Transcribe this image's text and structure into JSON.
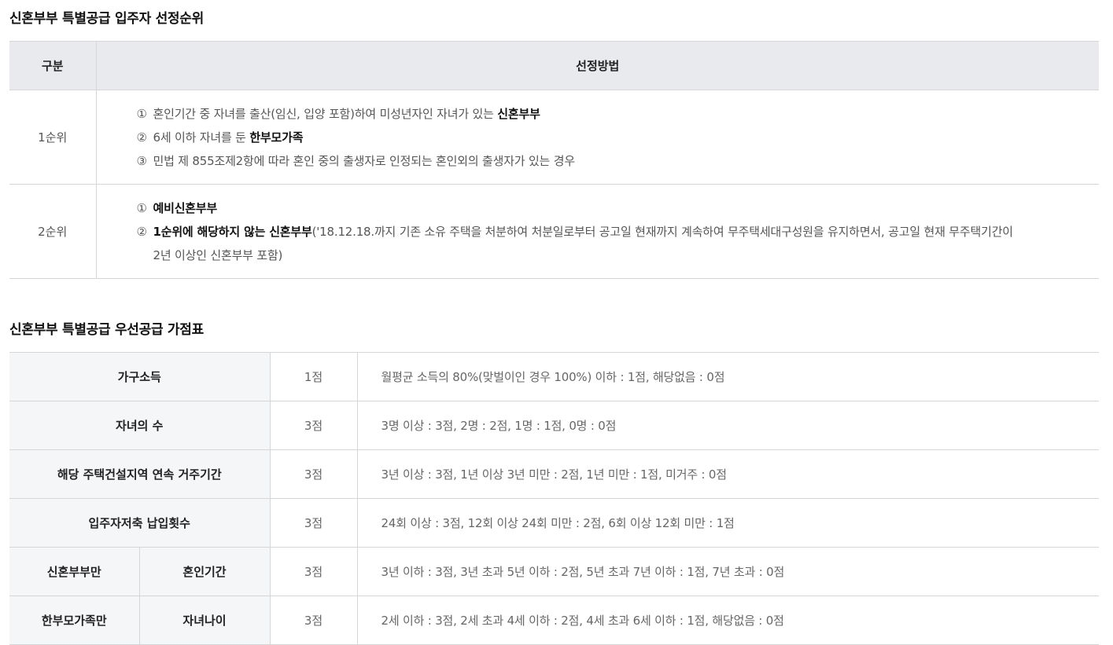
{
  "section1": {
    "title": "신혼부부 특별공급 입주자 선정순위",
    "headers": {
      "gubun": "구분",
      "method": "선정방법"
    },
    "rank1": {
      "label": "1순위",
      "items": [
        {
          "num": "①",
          "pre": "혼인기간 중 자녀를 출산(임신, 입양 포함)하여 미성년자인 자녀가 있는 ",
          "bold": "신혼부부",
          "post": ""
        },
        {
          "num": "②",
          "pre": "6세 이하 자녀를 둔 ",
          "bold": "한부모가족",
          "post": ""
        },
        {
          "num": "③",
          "pre": "민법 제 855조제2항에 따라 혼인 중의 출생자로 인정되는 혼인외의 출생자가 있는 경우",
          "bold": "",
          "post": ""
        }
      ]
    },
    "rank2": {
      "label": "2순위",
      "items": [
        {
          "num": "①",
          "pre": "",
          "bold": "예비신혼부부",
          "post": ""
        },
        {
          "num": "②",
          "pre": "",
          "bold": "1순위에 해당하지 않는 신혼부부",
          "post": "('18.12.18.까지 기존 소유 주택을 처분하여 처분일로부터 공고일 현재까지 계속하여 무주택세대구성원을 유지하면서, 공고일 현재 무주택기간이 2년 이상인 신혼부부 포함)"
        }
      ]
    }
  },
  "section2": {
    "title": "신혼부부 특별공급 우선공급 가점표",
    "rows": [
      {
        "item": "가구소득",
        "points": "1점",
        "criteria": "월평균 소득의 80%(맞벌이인 경우 100%) 이하 : 1점, 해당없음 : 0점"
      },
      {
        "item": "자녀의 수",
        "points": "3점",
        "criteria": "3명 이상 : 3점, 2명 : 2점, 1명 : 1점, 0명 : 0점"
      },
      {
        "item": "해당 주택건설지역 연속 거주기간",
        "points": "3점",
        "criteria": "3년 이상 : 3점, 1년 이상 3년 미만 : 2점, 1년 미만 : 1점, 미거주 : 0점"
      },
      {
        "item": "입주자저축 납입횟수",
        "points": "3점",
        "criteria": "24회 이상 : 3점, 12회 이상 24회 미만 : 2점, 6회 이상 12회 미만 : 1점"
      },
      {
        "group": "신혼부부만",
        "item": "혼인기간",
        "points": "3점",
        "criteria": "3년 이하 : 3점, 3년 초과 5년 이하 : 2점, 5년 초과 7년 이하 : 1점, 7년 초과 : 0점"
      },
      {
        "group": "한부모가족만",
        "item": "자녀나이",
        "points": "3점",
        "criteria": "2세 이하 : 3점, 2세 초과 4세 이하 : 2점, 4세 초과 6세 이하 : 1점, 해당없음 : 0점"
      }
    ]
  }
}
